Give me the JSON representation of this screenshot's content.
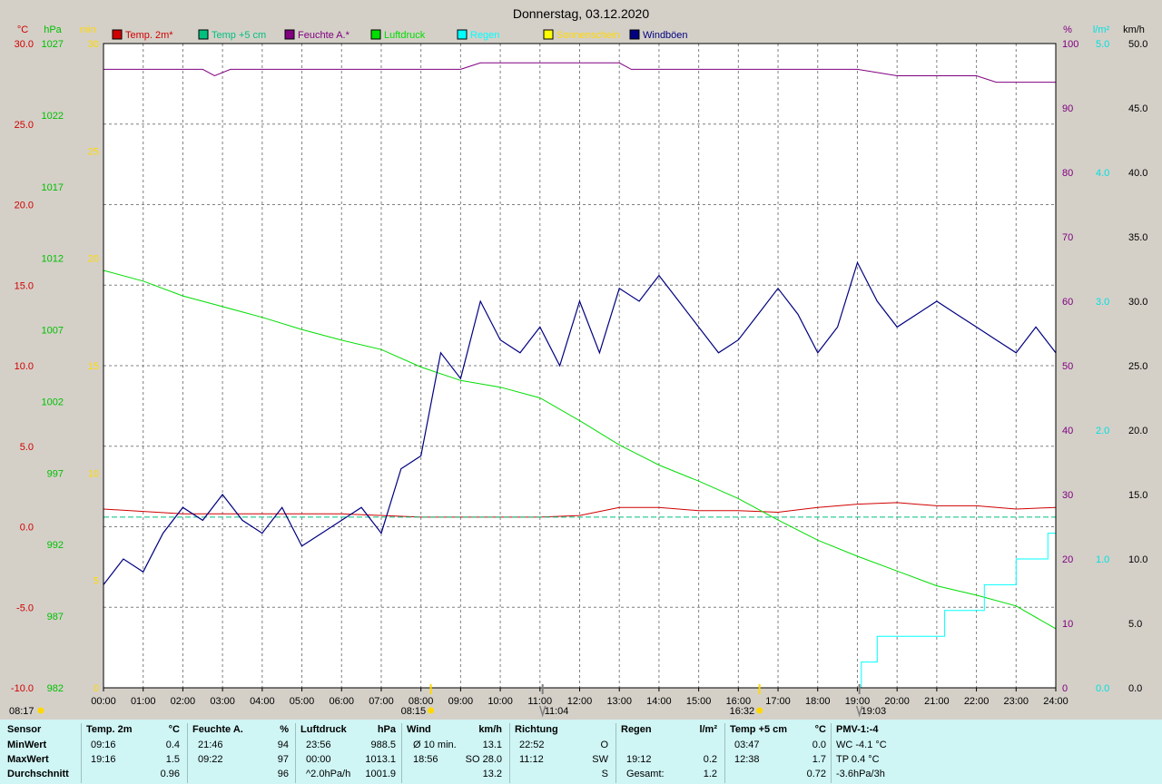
{
  "title": "Donnerstag, 03.12.2020",
  "units": {
    "temp": "°C",
    "hpa": "hPa",
    "min": "min",
    "pct": "%",
    "rain": "l/m²",
    "wind": "km/h"
  },
  "colors": {
    "temp2m": "#d00000",
    "temp5cm": "#00c080",
    "humidity": "#800080",
    "pressure": "#00dd00",
    "rain": "#00ffff",
    "sun": "#ffff00",
    "wind": "#000080",
    "temp_axis": "#d00000",
    "pressure_axis": "#00c000",
    "sun_axis": "#ffd800",
    "hum_axis": "#800080",
    "rain_axis": "#00e0e0",
    "wind_axis": "#000000"
  },
  "legend": [
    {
      "label": "Temp. 2m*",
      "color": "#d00000"
    },
    {
      "label": "Temp +5 cm",
      "color": "#00c080"
    },
    {
      "label": "Feuchte A.*",
      "color": "#800080"
    },
    {
      "label": "Luftdruck",
      "color": "#00dd00"
    },
    {
      "label": "Regen",
      "color": "#00ffff"
    },
    {
      "label": "Sonnenschein",
      "color": "#ffff00"
    },
    {
      "label": "Windböen",
      "color": "#000080"
    }
  ],
  "chart_data": {
    "type": "line",
    "title": "Donnerstag, 03.12.2020",
    "x_ticks": [
      "00:00",
      "01:00",
      "02:00",
      "03:00",
      "04:00",
      "05:00",
      "06:00",
      "07:00",
      "08:00",
      "09:00",
      "10:00",
      "11:00",
      "12:00",
      "13:00",
      "14:00",
      "15:00",
      "16:00",
      "17:00",
      "18:00",
      "19:00",
      "20:00",
      "21:00",
      "22:00",
      "23:00",
      "24:00"
    ],
    "axes": {
      "temp": {
        "label": "°C",
        "ticks": [
          "30.0",
          "25.0",
          "20.0",
          "15.0",
          "10.0",
          "5.0",
          "0.0",
          "-5.0",
          "-10.0"
        ],
        "ylim": [
          -10,
          30
        ]
      },
      "pressure": {
        "label": "hPa",
        "ticks": [
          "1027",
          "1022",
          "1017",
          "1012",
          "1007",
          "1002",
          "997",
          "992",
          "987",
          "982"
        ],
        "ylim": [
          982,
          1030
        ]
      },
      "sun": {
        "label": "min",
        "ticks": [
          "30",
          "25",
          "20",
          "15",
          "10",
          "5",
          "0"
        ],
        "ylim": [
          0,
          30
        ]
      },
      "humidity": {
        "label": "%",
        "ticks": [
          "100",
          "90",
          "80",
          "70",
          "60",
          "50",
          "40",
          "30",
          "20",
          "10",
          "0"
        ],
        "ylim": [
          0,
          100
        ]
      },
      "rain": {
        "label": "l/m²",
        "ticks": [
          "5.0",
          "4.0",
          "3.0",
          "2.0",
          "1.0",
          "0.0"
        ],
        "ylim": [
          0,
          5
        ]
      },
      "wind": {
        "label": "km/h",
        "ticks": [
          "50.0",
          "45.0",
          "40.0",
          "35.0",
          "30.0",
          "25.0",
          "20.0",
          "15.0",
          "10.0",
          "5.0",
          "0.0"
        ],
        "ylim": [
          0,
          50
        ]
      }
    },
    "series": [
      {
        "name": "Temp. 2m*",
        "axis": "temp",
        "x": [
          0,
          2,
          4,
          6,
          8,
          10,
          11,
          12,
          13,
          14,
          15,
          16,
          17,
          18,
          19,
          20,
          21,
          22,
          23,
          24
        ],
        "y": [
          1.1,
          0.8,
          0.8,
          0.8,
          0.6,
          0.6,
          0.6,
          0.7,
          1.2,
          1.2,
          1.0,
          1.0,
          0.9,
          1.2,
          1.4,
          1.5,
          1.3,
          1.3,
          1.1,
          1.2
        ]
      },
      {
        "name": "Temp +5 cm",
        "axis": "temp",
        "x": [
          0,
          2,
          4,
          6,
          8,
          10,
          11,
          12,
          13,
          14,
          15,
          16,
          17,
          18,
          19,
          20,
          21,
          22,
          23,
          24
        ],
        "y": [
          0.6,
          0.6,
          0.6,
          0.6,
          0.6,
          0.6,
          0.6,
          0.6,
          0.6,
          0.6,
          0.6,
          0.6,
          0.6,
          0.6,
          0.6,
          0.6,
          0.6,
          0.6,
          0.6,
          0.6
        ]
      },
      {
        "name": "Feuchte A.*",
        "axis": "humidity",
        "x": [
          0,
          2.5,
          2.8,
          3.2,
          4,
          6,
          8,
          9,
          9.5,
          10,
          12,
          13,
          13.3,
          14,
          16,
          18,
          19,
          20,
          21,
          22,
          22.5,
          23,
          24
        ],
        "y": [
          96,
          96,
          95,
          96,
          96,
          96,
          96,
          96,
          97,
          97,
          97,
          97,
          96,
          96,
          96,
          96,
          96,
          95,
          95,
          95,
          94,
          94,
          94
        ]
      },
      {
        "name": "Luftdruck",
        "axis": "pressure",
        "x": [
          0,
          1,
          2,
          3,
          4,
          5,
          6,
          7,
          8,
          9,
          10,
          11,
          12,
          13,
          14,
          15,
          16,
          17,
          18,
          19,
          20,
          21,
          22,
          23,
          24
        ],
        "y": [
          1013.1,
          1012.3,
          1011.2,
          1010.4,
          1009.6,
          1008.7,
          1007.9,
          1007.2,
          1005.9,
          1004.9,
          1004.4,
          1003.6,
          1001.9,
          1000.1,
          998.6,
          997.4,
          996.1,
          994.5,
          993.0,
          991.8,
          990.7,
          989.6,
          988.9,
          988.1,
          986.4
        ]
      },
      {
        "name": "Regen",
        "axis": "rain",
        "x": [
          0,
          19.1,
          19.5,
          20.2,
          21.2,
          22.2,
          23.0,
          23.8,
          24
        ],
        "y": [
          0,
          0.2,
          0.4,
          0.4,
          0.6,
          0.8,
          1.0,
          1.2,
          1.2
        ]
      },
      {
        "name": "Windböen",
        "axis": "wind",
        "x": [
          0,
          0.5,
          1,
          1.5,
          2,
          2.5,
          3,
          3.5,
          4,
          4.5,
          5,
          5.5,
          6,
          6.5,
          7,
          7.5,
          8,
          8.5,
          9,
          9.5,
          10,
          10.5,
          11,
          11.5,
          12,
          12.5,
          13,
          13.5,
          14,
          14.5,
          15,
          15.5,
          16,
          16.5,
          17,
          17.5,
          18,
          18.5,
          19,
          19.5,
          20,
          20.5,
          21,
          21.5,
          22,
          22.5,
          23,
          23.5,
          24
        ],
        "y": [
          8,
          10,
          9,
          12,
          14,
          13,
          15,
          13,
          12,
          14,
          11,
          12,
          13,
          14,
          12,
          17,
          18,
          26,
          24,
          30,
          27,
          26,
          28,
          25,
          30,
          26,
          31,
          30,
          32,
          30,
          28,
          26,
          27,
          29,
          31,
          29,
          26,
          28,
          33,
          30,
          28,
          29,
          30,
          29,
          28,
          27,
          26,
          28,
          26
        ]
      }
    ]
  },
  "markers": {
    "sunrise_label": "08:15",
    "sunset_label": "16:32",
    "left_label": "08:17",
    "moon1_label": "11:04",
    "moon2_label": "19:03"
  },
  "stats": {
    "headers": [
      {
        "label": "Sensor"
      },
      {
        "label": "Temp. 2m",
        "unit": "°C"
      },
      {
        "label": "Feuchte A.",
        "unit": "%"
      },
      {
        "label": "Luftdruck",
        "unit": "hPa"
      },
      {
        "label": "Wind",
        "unit": "km/h"
      },
      {
        "label": "Richtung"
      },
      {
        "label": "Regen",
        "unit": "l/m²"
      },
      {
        "label": "Temp +5 cm",
        "unit": "°C"
      },
      {
        "label": "PMV-1:-4"
      }
    ],
    "rows": [
      {
        "label": "MinWert",
        "t2_time": "09:16",
        "t2_val": "0.4",
        "hum_time": "21:46",
        "hum_val": "94",
        "p_time": "23:56",
        "p_val": "988.5",
        "w_time": "Ø 10 min.",
        "w_val": "13.1",
        "dir_time": "22:52",
        "dir_val": "O",
        "rain_time": "",
        "rain_val": "",
        "t5_time": "03:47",
        "t5_val": "0.0",
        "pmv": "WC -4.1 °C"
      },
      {
        "label": "MaxWert",
        "t2_time": "19:16",
        "t2_val": "1.5",
        "hum_time": "09:22",
        "hum_val": "97",
        "p_time": "00:00",
        "p_val": "1013.1",
        "w_time": "18:56",
        "w_val": "SO 28.0",
        "dir_time": "11:12",
        "dir_val": "SW",
        "rain_time": "19:12",
        "rain_val": "0.2",
        "t5_time": "12:38",
        "t5_val": "1.7",
        "pmv": "TP 0.4 °C"
      },
      {
        "label": "Durchschnitt",
        "t2_time": "",
        "t2_val": "0.96",
        "hum_time": "",
        "hum_val": "96",
        "p_time": "^2.0hPa/h",
        "p_val": "1001.9",
        "w_time": "",
        "w_val": "13.2",
        "dir_time": "",
        "dir_val": "S",
        "rain_time": "Gesamt:",
        "rain_val": "1.2",
        "t5_time": "",
        "t5_val": "0.72",
        "pmv": "-3.6hPa/3h"
      }
    ]
  }
}
